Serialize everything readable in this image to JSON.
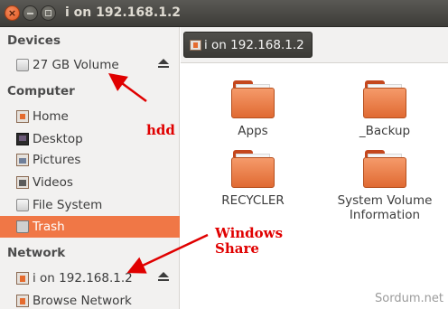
{
  "window": {
    "title": "i on 192.168.1.2",
    "close_glyph": "×"
  },
  "sidebar": {
    "devices_heading": "Devices",
    "devices": [
      {
        "label": "27 GB Volume",
        "icon": "drive-icon"
      }
    ],
    "computer_heading": "Computer",
    "computer": [
      {
        "label": "Home",
        "icon": "home-folder-icon"
      },
      {
        "label": "Desktop",
        "icon": "desktop-icon"
      },
      {
        "label": "Pictures",
        "icon": "pictures-folder-icon"
      },
      {
        "label": "Videos",
        "icon": "videos-folder-icon"
      },
      {
        "label": "File System",
        "icon": "filesystem-icon"
      },
      {
        "label": "Trash",
        "icon": "trash-icon",
        "selected": true
      }
    ],
    "network_heading": "Network",
    "network": [
      {
        "label": "i on 192.168.1.2",
        "icon": "network-share-icon"
      },
      {
        "label": "Browse Network",
        "icon": "network-icon"
      }
    ]
  },
  "pathbar": {
    "crumb": "i on 192.168.1.2"
  },
  "folders": [
    {
      "name": "Apps"
    },
    {
      "name": "_Backup"
    },
    {
      "name": "RECYCLER"
    },
    {
      "name_line1": "System Volume",
      "name_line2": "Information"
    }
  ],
  "annotations": {
    "hdd": "hdd",
    "windows": "Windows",
    "share": "Share"
  },
  "watermark": "Sordum.net",
  "colors": {
    "accent": "#f07746",
    "annotation": "#e00000",
    "titlebar": "#3d3c38"
  }
}
